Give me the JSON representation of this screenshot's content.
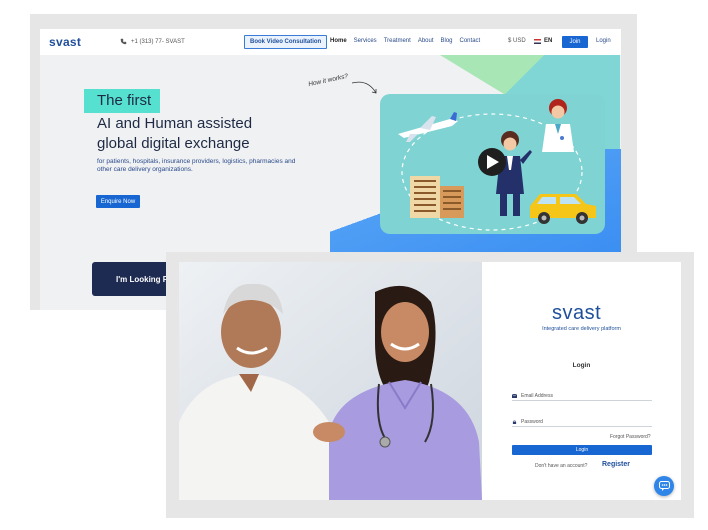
{
  "back_site": {
    "logo": "svast",
    "phone": "+1 (313) 77- SVAST",
    "book_video": "Book Video Consultation",
    "nav": [
      "Home",
      "Services",
      "Treatment",
      "About",
      "Blog",
      "Contact"
    ],
    "currency": "USD",
    "currency_symbol": "$",
    "language": "EN",
    "join": "Join",
    "login": "Login",
    "hero": {
      "highlight": "The first",
      "headline_line1": "AI and Human assisted",
      "headline_line2": "global digital exchange",
      "subtext": "for patients, hospitals, insurance providers, logistics, pharmacies and other care delivery organizations.",
      "enquire": "Enquire Now",
      "how_it_works": "How it works?"
    },
    "looking_for": "I'm Looking For"
  },
  "front_site": {
    "brand": "svast",
    "tagline": "Integrated care delivery platform",
    "login_title": "Login",
    "email_label": "Email Address",
    "password_label": "Password",
    "forgot": "Forgot Password?",
    "login_button": "Login",
    "no_account": "Don't have an account?",
    "register": "Register"
  },
  "colors": {
    "brand_blue": "#1f4f9b",
    "button_blue": "#1766d1",
    "teal": "#56e0cf",
    "navy": "#1d2a52"
  }
}
